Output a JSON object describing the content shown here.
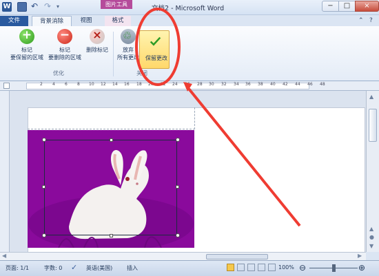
{
  "window": {
    "app_icon_letter": "W",
    "contextual_tab": "图片工具",
    "title": "文档2 - Microsoft Word",
    "minimize": "−",
    "maximize": "□",
    "close": "×"
  },
  "tabs": {
    "file": "文件",
    "background_removal": "背景消除",
    "view": "视图",
    "format": "格式",
    "help_icon": "?"
  },
  "ribbon": {
    "mark_keep_line1": "标记",
    "mark_keep_line2": "要保留的区域",
    "mark_remove_line1": "标记",
    "mark_remove_line2": "要删除的区域",
    "delete_mark": "删除标记",
    "optimize_group": "优化",
    "discard_line1": "放弃",
    "discard_line2": "所有更改",
    "keep_changes": "保留更改",
    "close_group": "关闭"
  },
  "ruler": {
    "numbers": [
      "2",
      "4",
      "6",
      "8",
      "10",
      "12",
      "14",
      "16",
      "18",
      "20",
      "22",
      "24",
      "26",
      "28",
      "30",
      "32",
      "34",
      "36",
      "38",
      "40",
      "42",
      "44",
      "46",
      "48"
    ]
  },
  "status": {
    "page": "页面: 1/1",
    "words": "字数: 0",
    "language": "英语(美国)",
    "insert": "插入",
    "zoom": "100%"
  },
  "colors": {
    "removed_background": "#8a0a9c",
    "annotation": "#ef3c32",
    "keep_button": "#ffd86b"
  }
}
